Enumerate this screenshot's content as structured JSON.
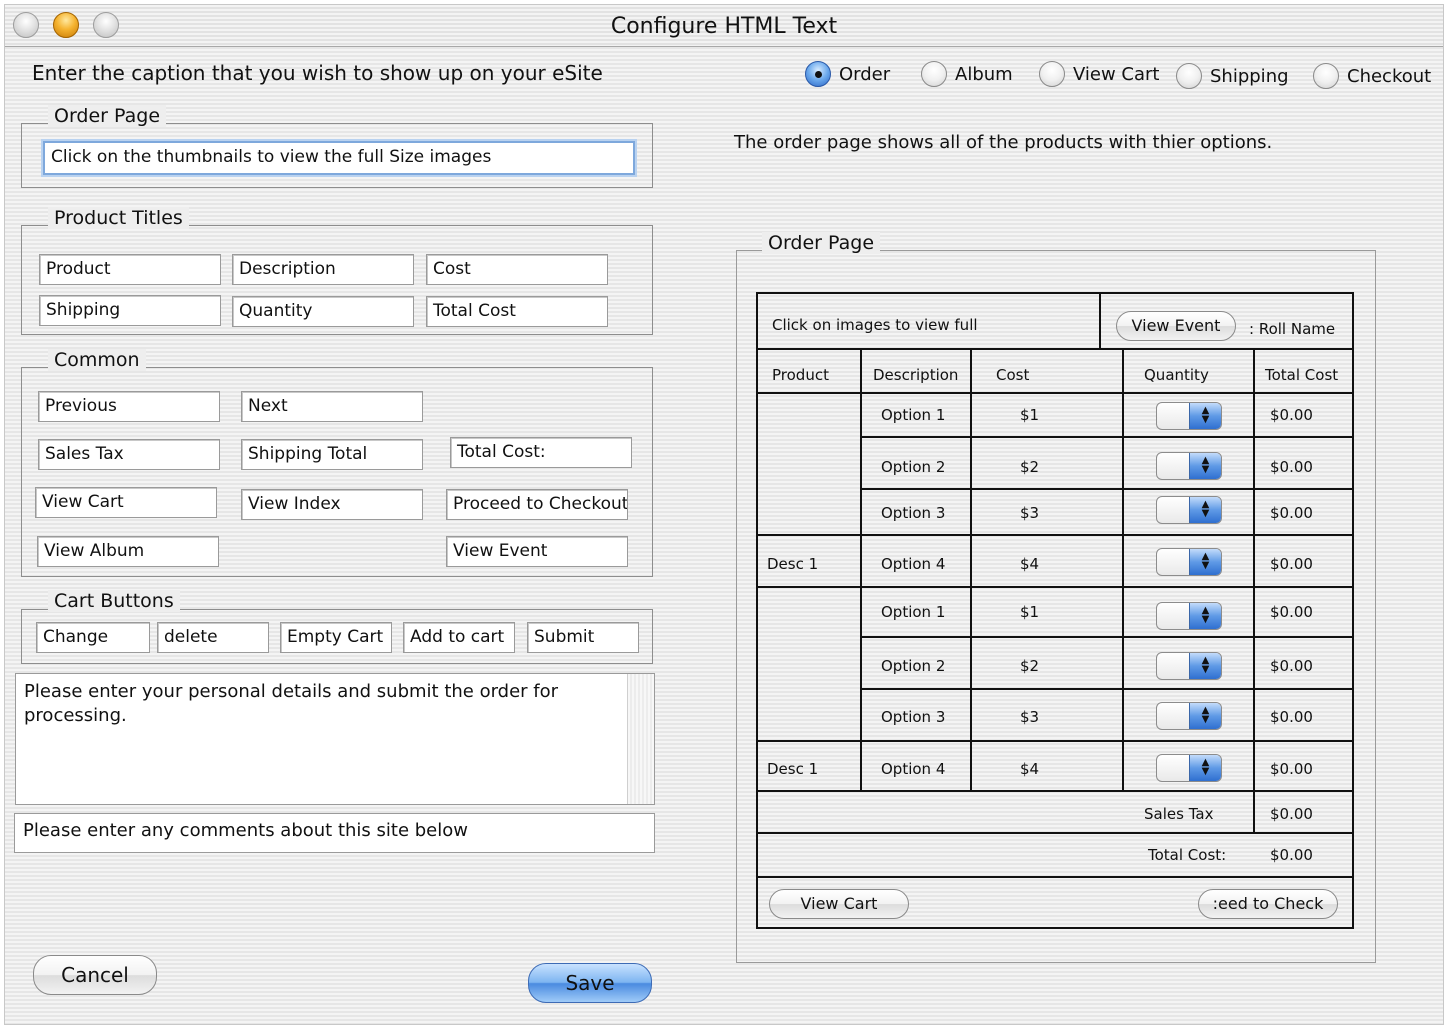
{
  "window": {
    "title": "Configure HTML  Text"
  },
  "caption_prompt": "Enter the caption that you wish to show up on your eSite",
  "page_selector": {
    "options": [
      "Order",
      "Album",
      "View Cart",
      "Shipping",
      "Checkout"
    ],
    "selected": "Order"
  },
  "order_page_group": {
    "legend": "Order Page",
    "caption_value": "Click on the thumbnails to view the full Size images"
  },
  "product_titles": {
    "legend": "Product Titles",
    "product": "Product",
    "description": "Description",
    "cost": "Cost",
    "shipping": "Shipping",
    "quantity": "Quantity",
    "total_cost": "Total Cost"
  },
  "common": {
    "legend": "Common",
    "previous": "Previous",
    "next": "Next",
    "sales_tax": "Sales Tax",
    "shipping_total": "Shipping Total",
    "total_cost": "Total Cost:",
    "view_cart": "View Cart",
    "view_index": "View Index",
    "proceed": "Proceed to Checkout",
    "view_album": "View Album",
    "view_event": "View Event"
  },
  "cart_buttons": {
    "legend": "Cart Buttons",
    "change": "Change",
    "delete": "delete",
    "empty_cart": "Empty Cart",
    "add_to_cart": "Add to cart",
    "submit": "Submit"
  },
  "personal_details_text": "Please enter your personal details and submit the order for processing.",
  "comments_text": "Please enter any comments about this site below",
  "buttons": {
    "cancel": "Cancel",
    "save": "Save"
  },
  "page_description": "The order page shows all of the products with thier options.",
  "preview": {
    "legend": "Order Page",
    "caption": "Click on images to view full",
    "view_event_button": "View Event",
    "roll_name": ": Roll Name",
    "headers": [
      "Product",
      "Description",
      "Cost",
      "Quantity",
      "Total Cost"
    ],
    "rows": [
      {
        "product": "",
        "option": "Option 1",
        "cost": "$1",
        "total": "$0.00"
      },
      {
        "product": "",
        "option": "Option 2",
        "cost": "$2",
        "total": "$0.00"
      },
      {
        "product": "",
        "option": "Option 3",
        "cost": "$3",
        "total": "$0.00"
      },
      {
        "product": "Desc 1",
        "option": "Option 4",
        "cost": "$4",
        "total": "$0.00"
      },
      {
        "product": "",
        "option": "Option 1",
        "cost": "$1",
        "total": "$0.00"
      },
      {
        "product": "",
        "option": "Option 2",
        "cost": "$2",
        "total": "$0.00"
      },
      {
        "product": "",
        "option": "Option 3",
        "cost": "$3",
        "total": "$0.00"
      },
      {
        "product": "Desc 1",
        "option": "Option 4",
        "cost": "$4",
        "total": "$0.00"
      }
    ],
    "sales_tax_label": "Sales Tax",
    "sales_tax_value": "$0.00",
    "total_cost_label": "Total Cost:",
    "total_cost_value": "$0.00",
    "view_cart_button": "View Cart",
    "proceed_button": ":eed to Check"
  }
}
